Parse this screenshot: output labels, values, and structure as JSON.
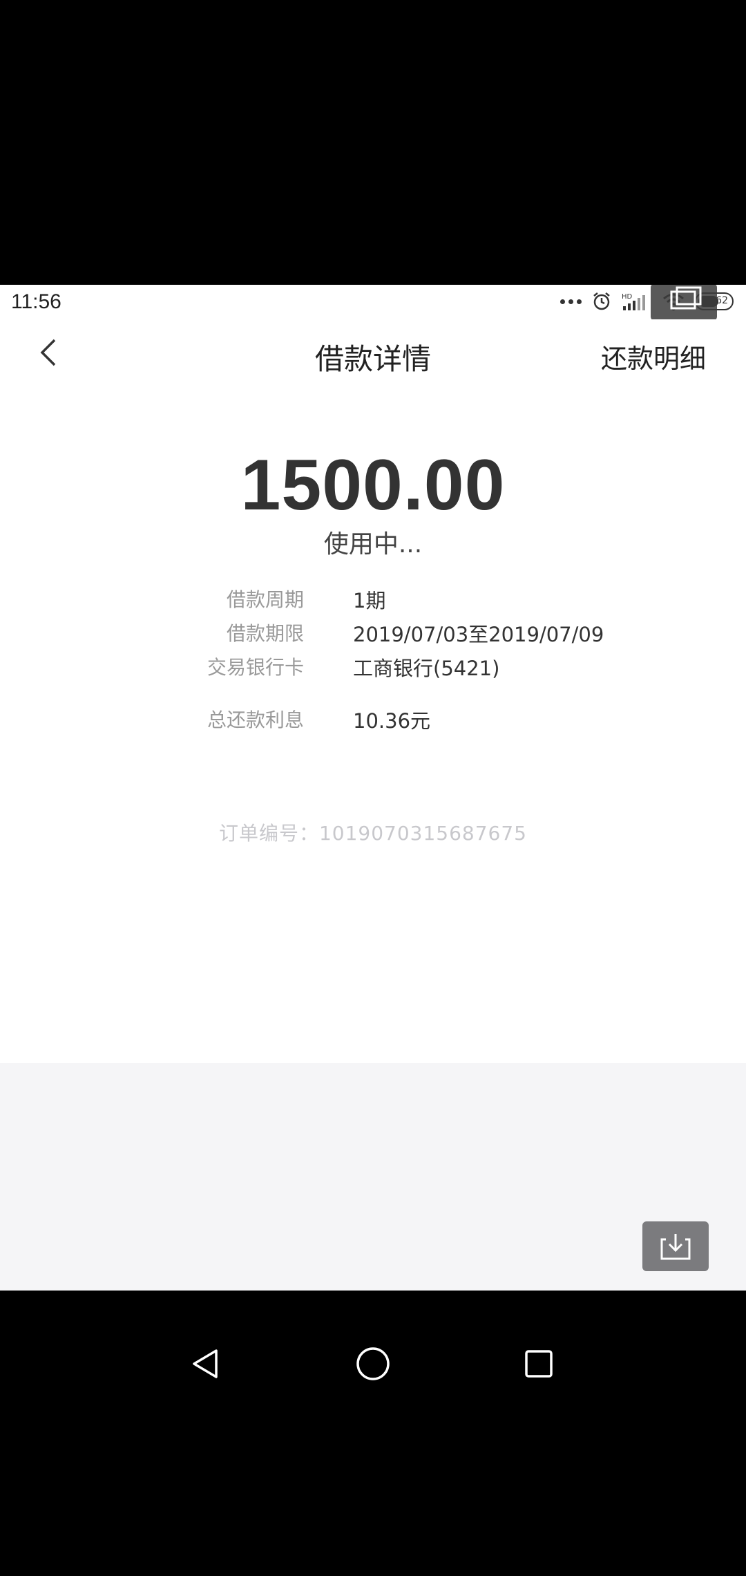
{
  "status_bar": {
    "time": "11:56",
    "battery": "62"
  },
  "nav": {
    "title": "借款详情",
    "right_action": "还款明细"
  },
  "loan": {
    "amount": "1500.00",
    "status": "使用中...",
    "details": [
      {
        "label": "借款周期",
        "value": "1期"
      },
      {
        "label": "借款期限",
        "value": "2019/07/03至2019/07/09"
      },
      {
        "label": "交易银行卡",
        "value": "工商银行(5421)"
      },
      {
        "label": "总还款利息",
        "value": "10.36元"
      }
    ]
  },
  "order": {
    "number_text": "订单编号：1019070315687675"
  },
  "icons": {
    "back": "chevron-left-icon",
    "download": "download-icon",
    "nav_back": "triangle-back-icon",
    "nav_home": "circle-home-icon",
    "nav_recent": "square-recent-icon"
  }
}
